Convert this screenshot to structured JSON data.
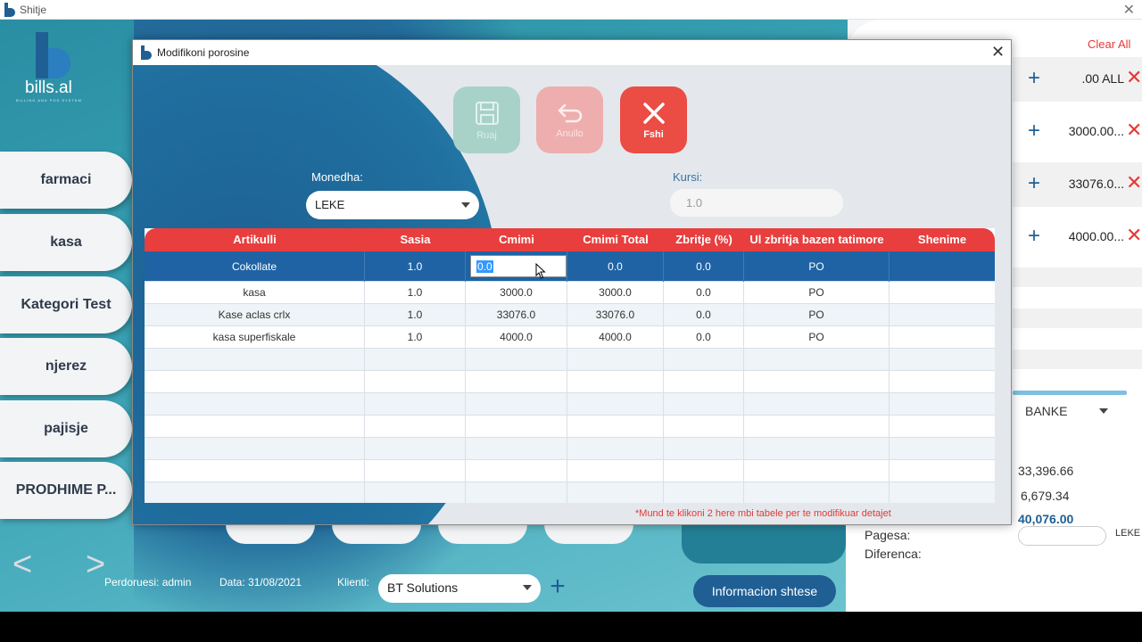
{
  "window": {
    "title": "Shitje"
  },
  "brand": {
    "name": "bills.al",
    "tagline": "BILLING AND POS SYSTEM"
  },
  "categories": [
    "farmaci",
    "kasa",
    "Kategori Test",
    "njerez",
    "pajisje",
    "PRODHIME P..."
  ],
  "nav": {
    "prev": "<",
    "next": ">"
  },
  "footer": {
    "user_label": "Perdoruesi: admin",
    "date_label": "Data: 31/08/2021",
    "client_label": "Klienti:",
    "client_value": "BT Solutions",
    "info_button": "Informacion shtese"
  },
  "right_panel": {
    "clear_all": "Clear All",
    "items": [
      ".00 ALL",
      "3000.00...",
      "33076.0...",
      "4000.00..."
    ],
    "payment_method": "BANKE",
    "totals": [
      "33,396.66",
      "6,679.34",
      "40,076.00"
    ],
    "pagesa_label": "Pagesa:",
    "diferenca_label": "Diferenca:",
    "currency": "LEKE"
  },
  "modal": {
    "title": "Modifikoni porosine",
    "buttons": {
      "ruaj": "Ruaj",
      "anullo": "Anullo",
      "fshi": "Fshi"
    },
    "monedha_label": "Monedha:",
    "monedha_value": "LEKE",
    "kursi_label": "Kursi:",
    "kursi_value": "1.0",
    "columns": [
      "Artikulli",
      "Sasia",
      "Cmimi",
      "Cmimi Total",
      "Zbritje (%)",
      "Ul zbritja bazen tatimore",
      "Shenime"
    ],
    "rows": [
      [
        "Cokollate",
        "1.0",
        "0.0",
        "0.0",
        "0.0",
        "PO",
        ""
      ],
      [
        "kasa",
        "1.0",
        "3000.0",
        "3000.0",
        "0.0",
        "PO",
        ""
      ],
      [
        "Kase aclas crlx",
        "1.0",
        "33076.0",
        "33076.0",
        "0.0",
        "PO",
        ""
      ],
      [
        "kasa superfiskale",
        "1.0",
        "4000.0",
        "4000.0",
        "0.0",
        "PO",
        ""
      ]
    ],
    "editing_value": "0.0",
    "note": "*Mund te klikoni 2 here mbi tabele per te modifikuar detajet"
  },
  "colors": {
    "primary": "#1f5f94",
    "danger": "#e83e3e",
    "teal": "#2a8ea3"
  }
}
